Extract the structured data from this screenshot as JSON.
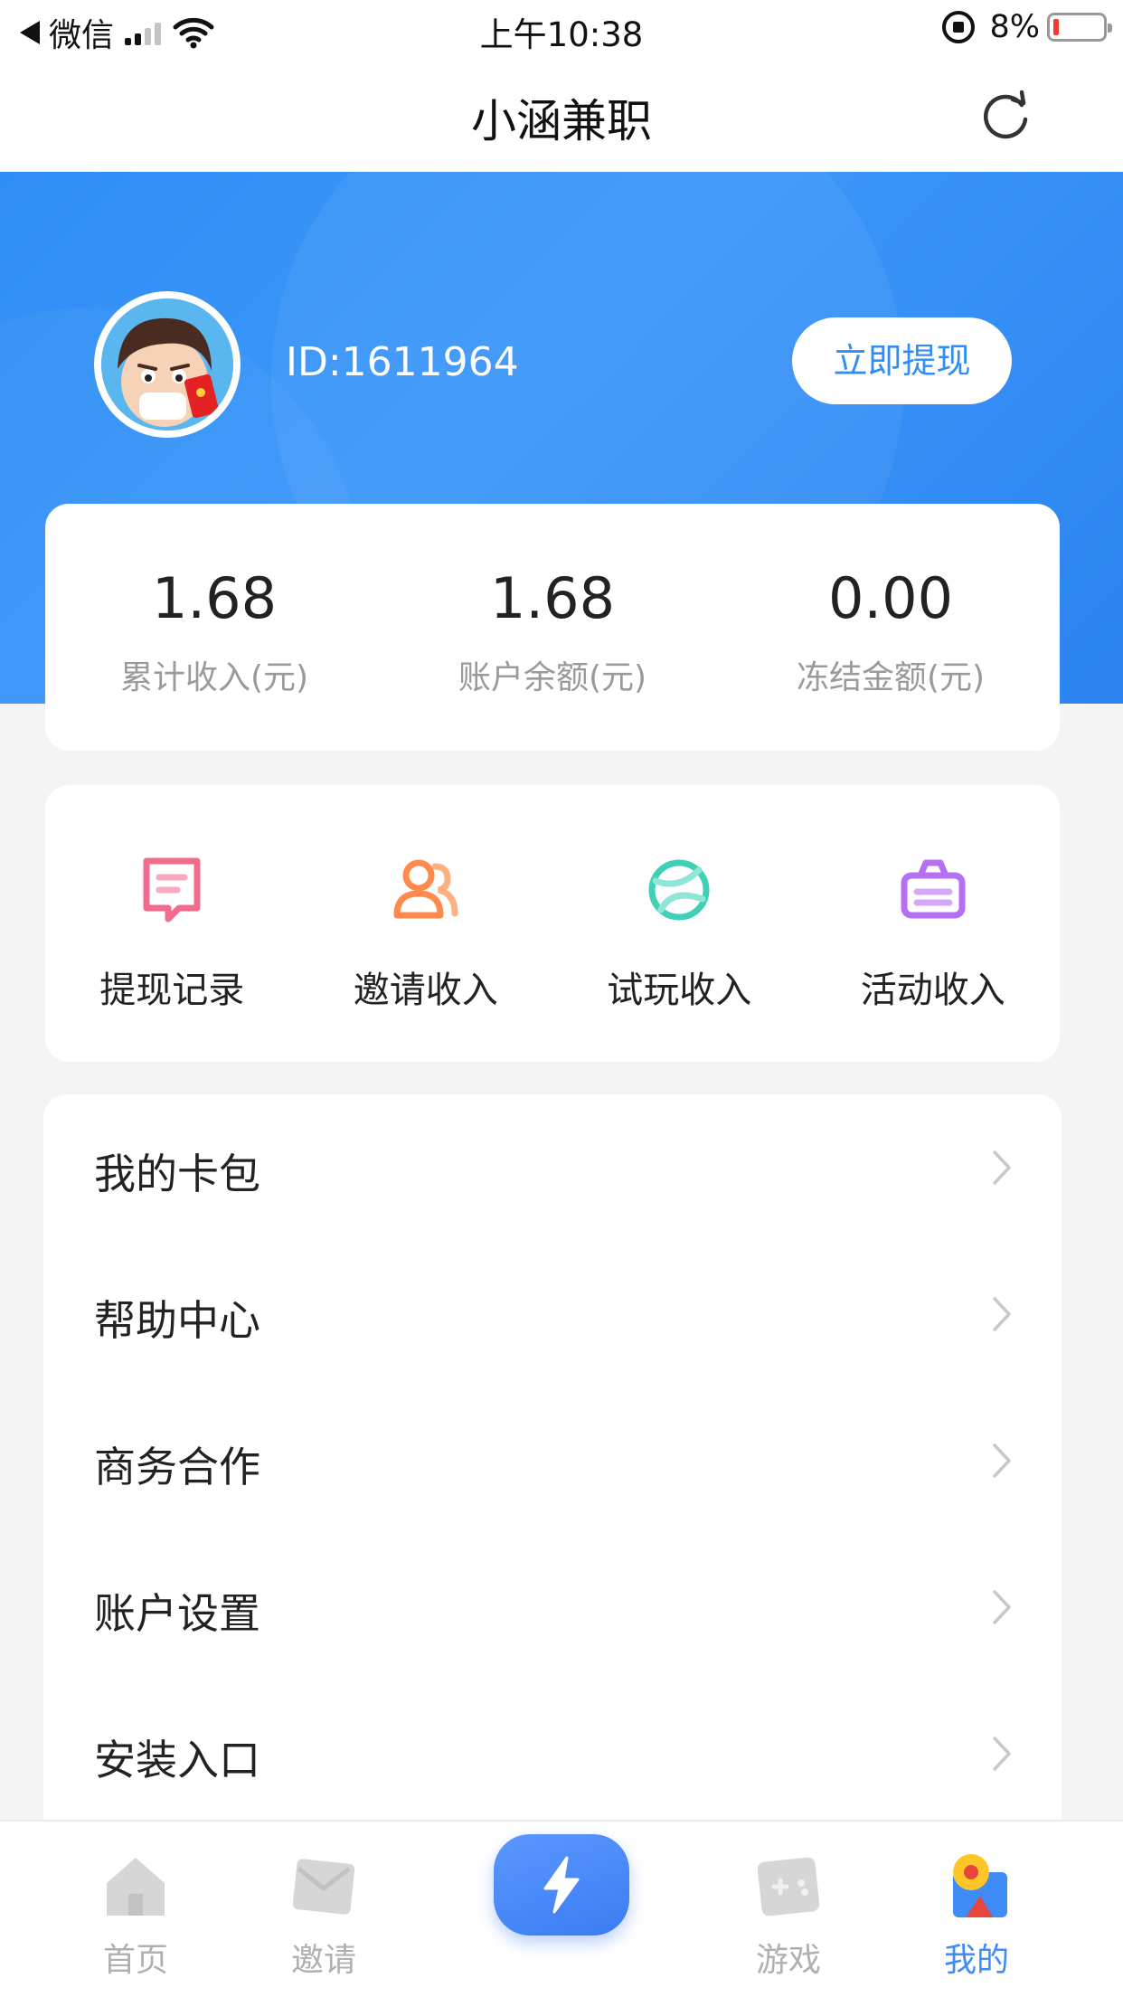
{
  "status_bar": {
    "back_app": "微信",
    "time": "上午10:38",
    "battery": "8%"
  },
  "nav": {
    "title": "小涵兼职"
  },
  "profile": {
    "id_text": "ID:1611964",
    "withdraw_button": "立即提现"
  },
  "stats": [
    {
      "value": "1.68",
      "label": "累计收入(元)"
    },
    {
      "value": "1.68",
      "label": "账户余额(元)"
    },
    {
      "value": "0.00",
      "label": "冻结金额(元)"
    }
  ],
  "quick_actions": [
    {
      "label": "提现记录",
      "icon": "receipt-icon",
      "color": "#f26b8a"
    },
    {
      "label": "邀请收入",
      "icon": "people-icon",
      "color": "#ff8a4c"
    },
    {
      "label": "试玩收入",
      "icon": "ball-icon",
      "color": "#3fd0b6"
    },
    {
      "label": "活动收入",
      "icon": "basket-icon",
      "color": "#b46ff2"
    }
  ],
  "menu": [
    {
      "label": "我的卡包"
    },
    {
      "label": "帮助中心"
    },
    {
      "label": "商务合作"
    },
    {
      "label": "账户设置"
    },
    {
      "label": "安装入口"
    }
  ],
  "tabs": [
    {
      "label": "首页",
      "icon": "home-icon"
    },
    {
      "label": "邀请",
      "icon": "envelope-icon"
    },
    {
      "label": "",
      "icon": "lightning-icon"
    },
    {
      "label": "游戏",
      "icon": "gamepad-icon"
    },
    {
      "label": "我的",
      "icon": "profile-icon",
      "active": true
    }
  ],
  "colors": {
    "primary": "#2f8ef6",
    "tab_active": "#3f8cf7",
    "tab_inactive": "#b0b0b0"
  }
}
